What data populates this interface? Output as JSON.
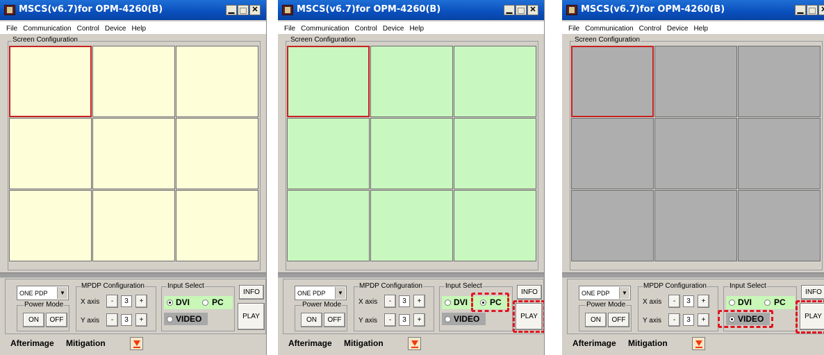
{
  "windows": [
    {
      "title": "MSCS(v6.7)for OPM-4260(B)",
      "menu": [
        "File",
        "Communication",
        "Control",
        "Device",
        "Help"
      ],
      "screen_configuration_label": "Screen Configuration",
      "cell_color": "#fefed8",
      "grid_rows": 3,
      "grid_cols": 3,
      "selected_cell": "row 1, col 1",
      "controls": {
        "pdp_select": "ONE PDP",
        "power_mode_label": "Power Mode",
        "power_on": "ON",
        "power_off": "OFF",
        "mpdp_config_label": "MPDP Configuration",
        "x_axis_label": "X axis",
        "x_axis_value": "3",
        "y_axis_label": "Y axis",
        "y_axis_value": "3",
        "minus": "-",
        "plus": "+",
        "input_select_label": "Input Select",
        "dvi": "DVI",
        "pc": "PC",
        "video": "VIDEO",
        "selected_input": "DVI",
        "info": "INFO",
        "play": "PLAY"
      },
      "afterimage_label": "Afterimage",
      "mitigation_label": "Mitigation"
    },
    {
      "title": "MSCS(v6.7)for OPM-4260(B)",
      "menu": [
        "File",
        "Communication",
        "Control",
        "Device",
        "Help"
      ],
      "screen_configuration_label": "Screen Configuration",
      "cell_color": "#c8f7bf",
      "grid_rows": 3,
      "grid_cols": 3,
      "selected_cell": "row 1, col 1",
      "controls": {
        "pdp_select": "ONE PDP",
        "power_mode_label": "Power Mode",
        "power_on": "ON",
        "power_off": "OFF",
        "mpdp_config_label": "MPDP Configuration",
        "x_axis_label": "X axis",
        "x_axis_value": "3",
        "y_axis_label": "Y axis",
        "y_axis_value": "3",
        "minus": "-",
        "plus": "+",
        "input_select_label": "Input Select",
        "dvi": "DVI",
        "pc": "PC",
        "video": "VIDEO",
        "selected_input": "PC",
        "info": "INFO",
        "play": "PLAY"
      },
      "afterimage_label": "Afterimage",
      "mitigation_label": "Mitigation"
    },
    {
      "title": "MSCS(v6.7)for OPM-4260(B)",
      "menu": [
        "File",
        "Communication",
        "Control",
        "Device",
        "Help"
      ],
      "screen_configuration_label": "Screen Configuration",
      "cell_color": "#aeaeae",
      "grid_rows": 3,
      "grid_cols": 3,
      "selected_cell": "row 1, col 1",
      "controls": {
        "pdp_select": "ONE PDP",
        "power_mode_label": "Power Mode",
        "power_on": "ON",
        "power_off": "OFF",
        "mpdp_config_label": "MPDP Configuration",
        "x_axis_label": "X axis",
        "x_axis_value": "3",
        "y_axis_label": "Y axis",
        "y_axis_value": "3",
        "minus": "-",
        "plus": "+",
        "input_select_label": "Input Select",
        "dvi": "DVI",
        "pc": "PC",
        "video": "VIDEO",
        "selected_input": "VIDEO",
        "info": "INFO",
        "play": "PLAY"
      },
      "afterimage_label": "Afterimage",
      "mitigation_label": "Mitigation"
    }
  ],
  "colors": {
    "selection_border": "#c82020",
    "highlight_dashed": "#e0141e",
    "titlebar": "#0a4fbd",
    "radio_green_bg": "#c8f7b8",
    "radio_gray_bg": "#a8a8a8"
  },
  "window_buttons": [
    "minimize",
    "maximize",
    "close"
  ],
  "icons": [
    "app-icon",
    "minimize-icon",
    "maximize-icon",
    "close-icon",
    "dropdown-arrow-icon",
    "orange-down-arrow-icon"
  ]
}
